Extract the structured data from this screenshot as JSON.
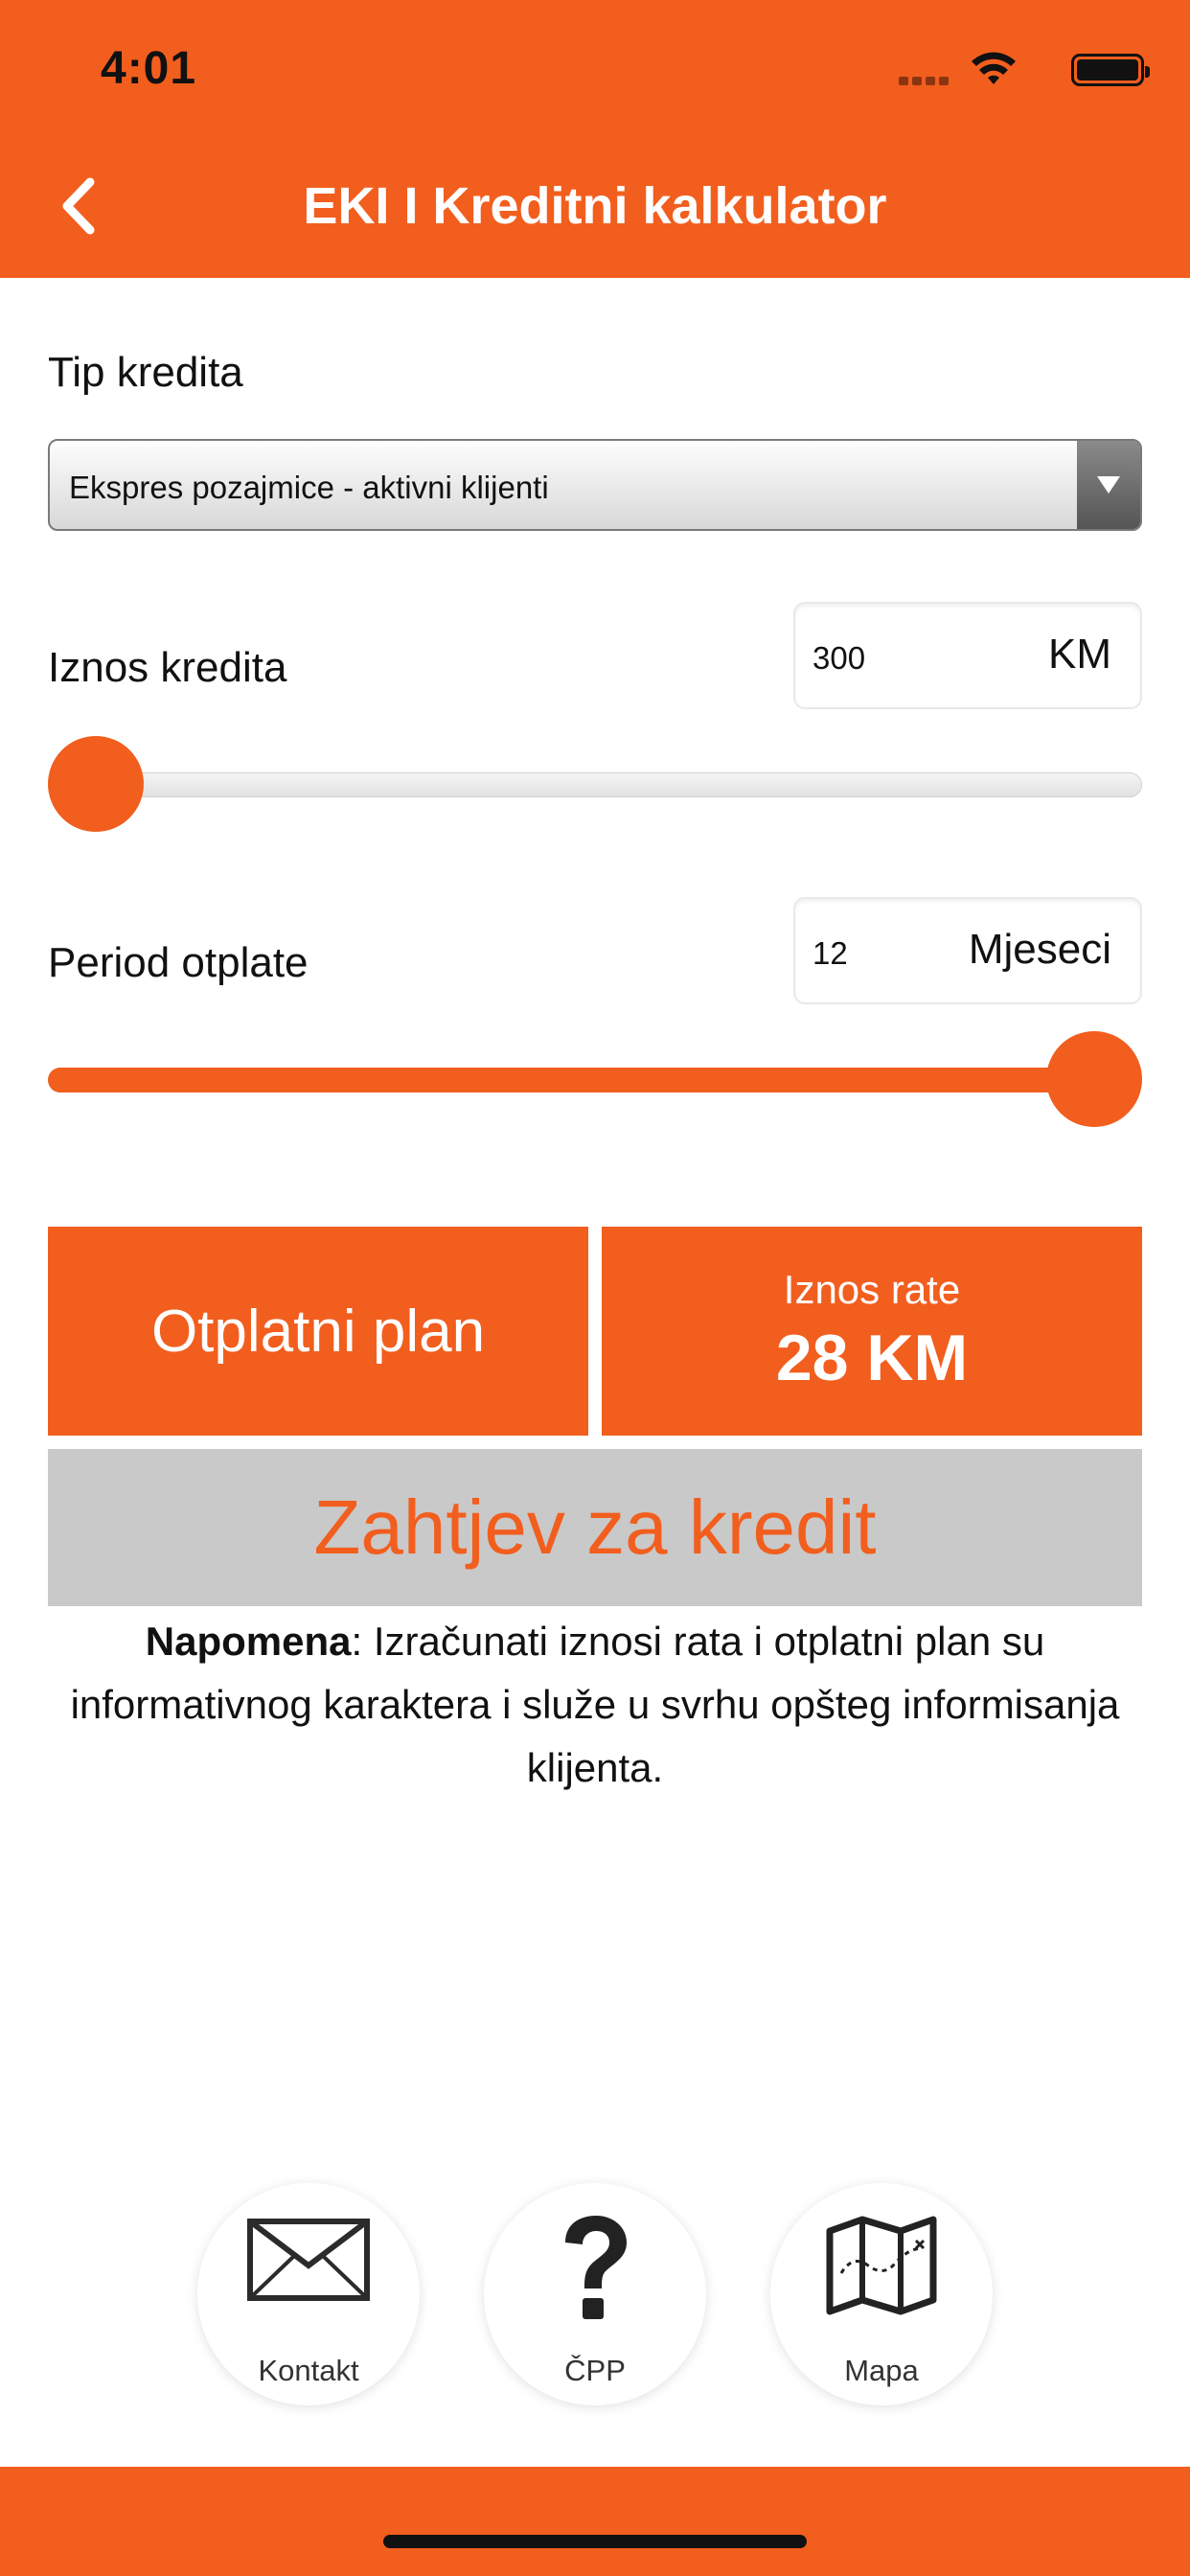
{
  "status_bar": {
    "time": "4:01"
  },
  "header": {
    "title": "EKI I Kreditni kalkulator"
  },
  "loan_type": {
    "label": "Tip kredita",
    "selected": "Ekspres pozajmice - aktivni klijenti"
  },
  "amount": {
    "label": "Iznos kredita",
    "value": "300",
    "unit": "KM",
    "slider_fraction": 0.0
  },
  "period": {
    "label": "Period otplate",
    "value": "12",
    "unit": "Mjeseci",
    "slider_fraction": 1.0
  },
  "actions": {
    "plan_label": "Otplatni plan",
    "rate_title": "Iznos rate",
    "rate_value": "28 KM",
    "request_label": "Zahtjev za kredit"
  },
  "note": {
    "bold": "Napomena",
    "text": ": Izračunati iznosi rata i otplatni plan su informativnog karaktera i služe u svrhu opšteg informisanja klijenta."
  },
  "quick_links": [
    {
      "label": "Kontakt",
      "icon": "envelope-icon"
    },
    {
      "label": "ČPP",
      "icon": "question-mark-icon"
    },
    {
      "label": "Mapa",
      "icon": "map-icon"
    }
  ],
  "colors": {
    "accent": "#f25e1e",
    "request_bg": "#c9c9c9"
  }
}
